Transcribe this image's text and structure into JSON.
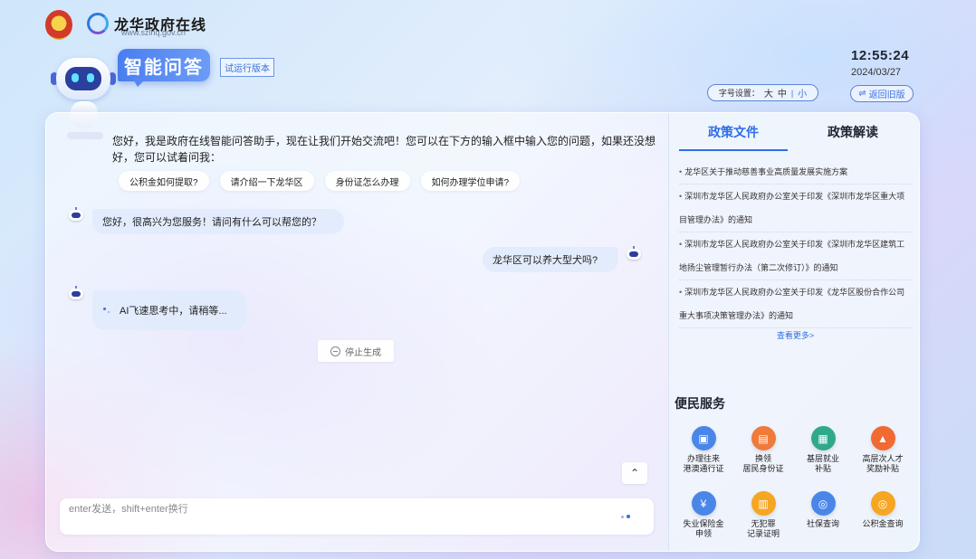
{
  "header": {
    "site_title": "龙华政府在线",
    "site_url": "www.szlhq.gov.cn",
    "app_title": "智能问答",
    "trial_label": "试运行版本",
    "time": "12:55:24",
    "date": "2024/03/27",
    "font_size": {
      "label": "字号设置：",
      "options": [
        "大",
        "中",
        "小"
      ],
      "selected": "小"
    },
    "old_version_label": "返回旧版"
  },
  "chat": {
    "intro": "您好，我是政府在线智能问答助手，现在让我们开始交流吧！您可以在下方的输入框中输入您的问题，如果还没想好，您可以试着问我：",
    "suggestions": [
      "公积金如何提取?",
      "请介绍一下龙华区",
      "身份证怎么办理",
      "如何办理学位申请?"
    ],
    "messages": [
      {
        "role": "bot",
        "text": "您好，很高兴为您服务！请问有什么可以帮您的？"
      },
      {
        "role": "user",
        "text": "龙华区可以养大型犬吗?"
      },
      {
        "role": "bot",
        "text": "AI飞速思考中，请稍等..."
      }
    ],
    "stop_label": "停止生成",
    "input_placeholder": "enter发送，shift+enter换行"
  },
  "sidebar": {
    "tabs": [
      "政策文件",
      "政策解读"
    ],
    "active_tab": "政策文件",
    "policy_items": [
      "龙华区关于推动慈善事业高质量发展实施方案",
      "深圳市龙华区人民政府办公室关于印发《深圳市龙华区重大项目管理办法》的通知",
      "深圳市龙华区人民政府办公室关于印发《深圳市龙华区建筑工地扬尘管理暂行办法（第二次修订）》的通知",
      "深圳市龙华区人民政府办公室关于印发《龙华区股份合作公司重大事项决策管理办法》的通知"
    ],
    "more_label": "查看更多>",
    "services_title": "便民服务",
    "services": [
      {
        "label1": "办理往来",
        "label2": "港澳通行证",
        "icon": "passport-icon",
        "color": "#4a86e8"
      },
      {
        "label1": "换领",
        "label2": "居民身份证",
        "icon": "id-card-icon",
        "color": "#f07a3a"
      },
      {
        "label1": "基层就业",
        "label2": "补贴",
        "icon": "briefcase-icon",
        "color": "#2fa98a"
      },
      {
        "label1": "高层次人才",
        "label2": "奖励补贴",
        "icon": "graduation-cap-icon",
        "color": "#f06a32"
      },
      {
        "label1": "失业保险金",
        "label2": "申领",
        "icon": "money-bag-icon",
        "color": "#4a86e8"
      },
      {
        "label1": "无犯罪",
        "label2": "记录证明",
        "icon": "document-icon",
        "color": "#f5a623"
      },
      {
        "label1": "社保查询",
        "label2": "",
        "icon": "search-shield-icon",
        "color": "#4a86e8"
      },
      {
        "label1": "公积金查询",
        "label2": "",
        "icon": "search-coin-icon",
        "color": "#f5a623"
      }
    ]
  }
}
